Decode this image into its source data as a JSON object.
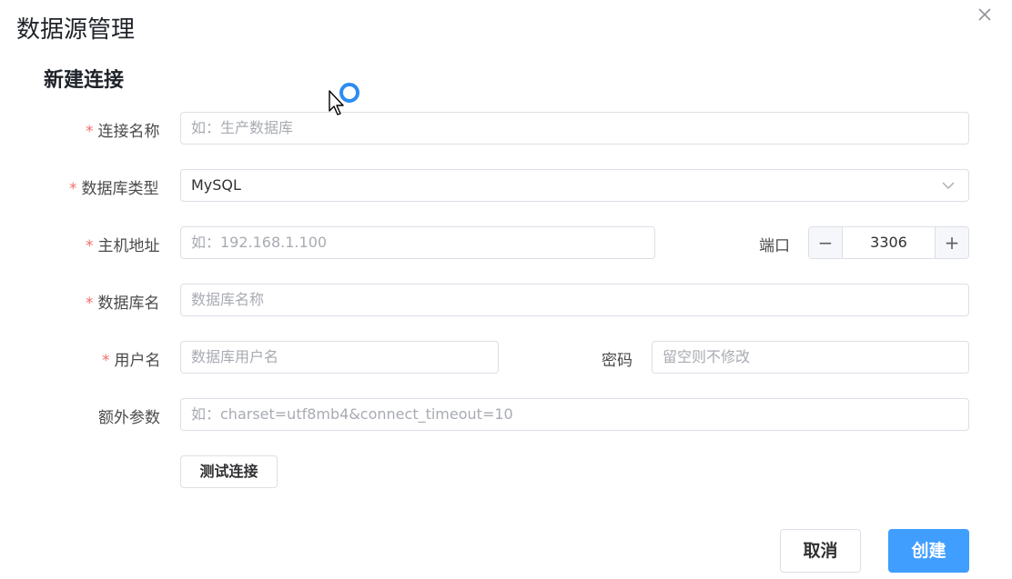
{
  "dialog": {
    "title": "数据源管理"
  },
  "section": {
    "title": "新建连接"
  },
  "form": {
    "required_mark": "*",
    "connection_name": {
      "label": "连接名称",
      "placeholder": "如：生产数据库"
    },
    "db_type": {
      "label": "数据库类型",
      "value": "MySQL"
    },
    "host": {
      "label": "主机地址",
      "placeholder": "如：192.168.1.100"
    },
    "port": {
      "label": "端口",
      "value": "3306",
      "minus": "−",
      "plus": "+"
    },
    "db_name": {
      "label": "数据库名",
      "placeholder": "数据库名称"
    },
    "username": {
      "label": "用户名",
      "placeholder": "数据库用户名"
    },
    "password": {
      "label": "密码",
      "placeholder": "留空则不修改"
    },
    "extra_params": {
      "label": "额外参数",
      "placeholder": "如：charset=utf8mb4&connect_timeout=10"
    }
  },
  "buttons": {
    "test": "测试连接",
    "cancel": "取消",
    "create": "创建"
  },
  "colors": {
    "primary": "#409eff",
    "required": "#f56c6c",
    "border": "#dcdfe6"
  },
  "icons": {
    "close": "close-icon",
    "dropdown": "chevron-down-icon",
    "cursor": "mouse-pointer-icon",
    "loading": "loading-spinner-icon"
  }
}
